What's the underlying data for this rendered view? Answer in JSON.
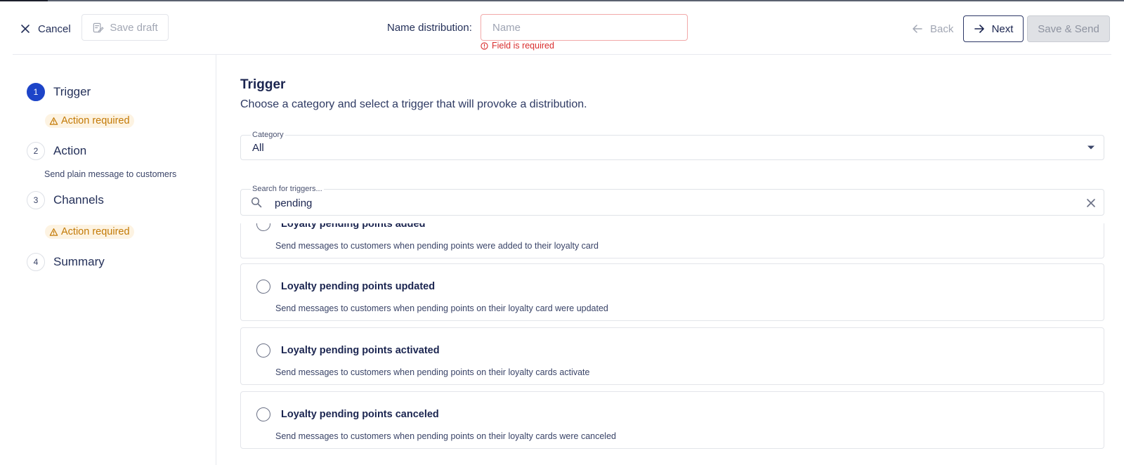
{
  "header": {
    "cancel_label": "Cancel",
    "save_draft_label": "Save draft",
    "name_label": "Name distribution:",
    "name_placeholder": "Name",
    "name_value": "",
    "name_error": "Field is required",
    "back_label": "Back",
    "next_label": "Next",
    "save_send_label": "Save & Send"
  },
  "steps": [
    {
      "number": "1",
      "label": "Trigger",
      "active": true,
      "badge": "Action required"
    },
    {
      "number": "2",
      "label": "Action",
      "active": false,
      "sub": "Send plain message to customers"
    },
    {
      "number": "3",
      "label": "Channels",
      "active": false,
      "badge": "Action required"
    },
    {
      "number": "4",
      "label": "Summary",
      "active": false
    }
  ],
  "main": {
    "title": "Trigger",
    "subtitle": "Choose a category and select a trigger that will provoke a distribution.",
    "category": {
      "label": "Category",
      "value": "All"
    },
    "search": {
      "label": "Search for triggers...",
      "value": "pending"
    },
    "triggers": [
      {
        "name": "Loyalty pending points added",
        "description": "Send messages to customers when pending points were added to their loyalty card"
      },
      {
        "name": "Loyalty pending points updated",
        "description": "Send messages to customers when pending points on their loyalty card were updated"
      },
      {
        "name": "Loyalty pending points activated",
        "description": "Send messages to customers when pending points on their loyalty cards activate"
      },
      {
        "name": "Loyalty pending points canceled",
        "description": "Send messages to customers when pending points on their loyalty cards were canceled"
      }
    ]
  },
  "colors": {
    "accent": "#1d44c8",
    "warning": "#c37a06",
    "warning_bg": "#fdf3e2",
    "error": "#d92d2d"
  },
  "icons": {
    "cancel": "close-icon",
    "save_draft": "draft-icon",
    "error": "alert-circle-icon",
    "back": "arrow-left-icon",
    "next": "arrow-right-icon",
    "badge": "warning-triangle-icon",
    "category": "caret-down-icon",
    "search": "search-icon",
    "clear": "clear-icon"
  }
}
